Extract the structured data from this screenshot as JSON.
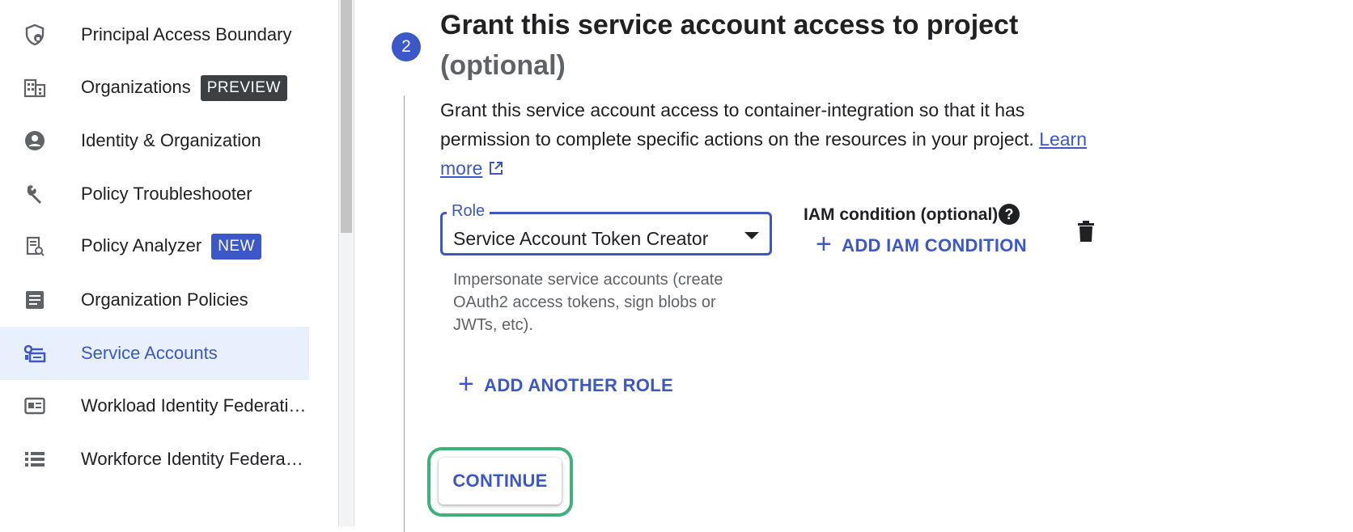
{
  "sidebar": {
    "items": [
      {
        "label": "Principal Access Boundary",
        "icon": "shield-lock-icon"
      },
      {
        "label": "Organizations",
        "icon": "building-icon",
        "badge": "PREVIEW"
      },
      {
        "label": "Identity & Organization",
        "icon": "account-circle-icon"
      },
      {
        "label": "Policy Troubleshooter",
        "icon": "wrench-icon"
      },
      {
        "label": "Policy Analyzer",
        "icon": "document-search-icon",
        "badge": "NEW"
      },
      {
        "label": "Organization Policies",
        "icon": "list-document-icon"
      },
      {
        "label": "Service Accounts",
        "icon": "service-account-icon",
        "active": true
      },
      {
        "label": "Workload Identity Federati…",
        "icon": "id-card-icon"
      },
      {
        "label": "Workforce Identity Federa…",
        "icon": "list-icon"
      }
    ]
  },
  "step": {
    "number": "2",
    "title": "Grant this service account access to project",
    "subtitle": "(optional)",
    "description": "Grant this service account access to container-integration so that it has permission to complete specific actions on the resources in your project.",
    "learn_more": "Learn more"
  },
  "role": {
    "label": "Role",
    "value": "Service Account Token Creator",
    "help": "Impersonate service accounts (create OAuth2 access tokens, sign blobs or JWTs, etc)."
  },
  "iam": {
    "title": "IAM condition (optional)",
    "add_condition": "ADD IAM CONDITION"
  },
  "actions": {
    "add_another_role": "ADD ANOTHER ROLE",
    "continue": "CONTINUE"
  },
  "colors": {
    "accent": "#3c57c7",
    "highlight": "#3cb37a",
    "active_bg": "#e8f0fe"
  }
}
